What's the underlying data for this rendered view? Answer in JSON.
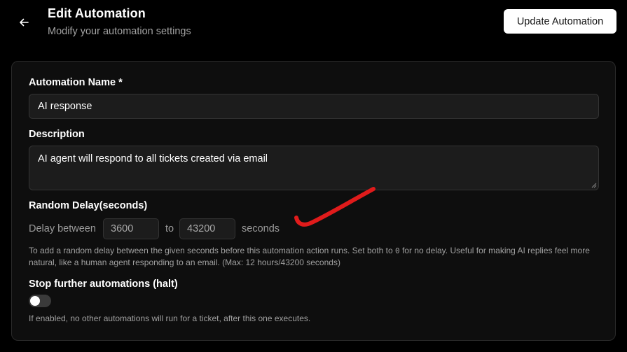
{
  "header": {
    "back_icon": "arrow-left-icon",
    "title": "Edit Automation",
    "subtitle": "Modify your automation settings",
    "update_button_label": "Update Automation"
  },
  "form": {
    "name": {
      "label": "Automation Name *",
      "value": "AI response"
    },
    "description": {
      "label": "Description",
      "value": "AI agent will respond to all tickets created via email"
    },
    "random_delay": {
      "label": "Random Delay(seconds)",
      "prefix": "Delay between",
      "min_value": "3600",
      "joiner": "to",
      "max_value": "43200",
      "suffix": "seconds",
      "help_part1": "To add a random delay between the given seconds before this automation action runs. Set both to ",
      "help_code": "0",
      "help_part2": " for no delay. Useful for making AI replies feel more natural, like a human agent responding to an email. (Max: 12 hours/43200 seconds)"
    },
    "halt": {
      "label": "Stop further automations (halt)",
      "enabled": false,
      "help": "If enabled, no other automations will run for a ticket, after this one executes."
    }
  },
  "colors": {
    "background": "#000000",
    "card": "#0e0e0e",
    "input_bg": "#1c1c1c",
    "annotation_stroke": "#e01b1b"
  }
}
